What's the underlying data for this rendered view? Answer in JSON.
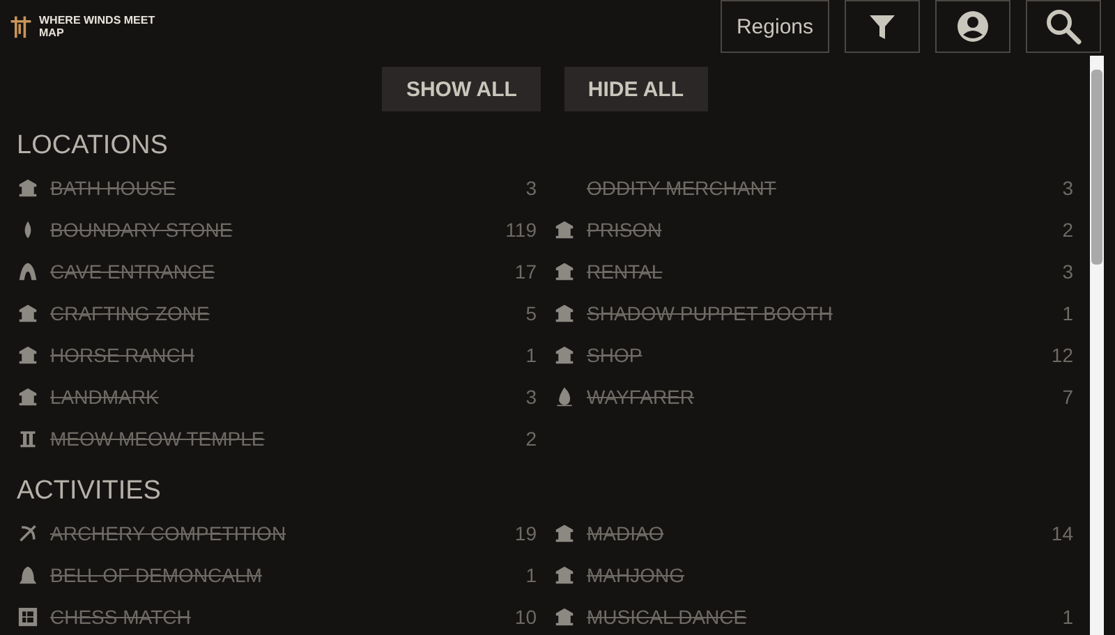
{
  "logo": {
    "title": "WHERE WINDS MEET",
    "subtitle": "MAP"
  },
  "header_buttons": {
    "regions": "Regions"
  },
  "actions": [
    "SHOW ALL",
    "HIDE ALL"
  ],
  "sections": [
    {
      "title": "LOCATIONS",
      "items": [
        {
          "label": "BATH HOUSE",
          "count": "3",
          "hidden": true
        },
        {
          "label": "BOUNDARY STONE",
          "count": "119",
          "hidden": true
        },
        {
          "label": "CAVE ENTRANCE",
          "count": "17",
          "hidden": true
        },
        {
          "label": "CRAFTING ZONE",
          "count": "5",
          "hidden": true
        },
        {
          "label": "HORSE RANCH",
          "count": "1",
          "hidden": true
        },
        {
          "label": "LANDMARK",
          "count": "3",
          "hidden": true
        },
        {
          "label": "MEOW MEOW TEMPLE",
          "count": "2",
          "hidden": true
        },
        {
          "label": "ODDITY MERCHANT",
          "count": "3",
          "hidden": true
        },
        {
          "label": "PRISON",
          "count": "2",
          "hidden": true
        },
        {
          "label": "RENTAL",
          "count": "3",
          "hidden": true
        },
        {
          "label": "SHADOW PUPPET BOOTH",
          "count": "1",
          "hidden": true
        },
        {
          "label": "SHOP",
          "count": "12",
          "hidden": true
        },
        {
          "label": "WAYFARER",
          "count": "7",
          "hidden": true
        }
      ]
    },
    {
      "title": "ACTIVITIES",
      "items": [
        {
          "label": "ARCHERY COMPETITION",
          "count": "19",
          "hidden": true
        },
        {
          "label": "BELL OF DEMONCALM",
          "count": "1",
          "hidden": true
        },
        {
          "label": "CHESS MATCH",
          "count": "10",
          "hidden": true
        },
        {
          "label": "MADIAO",
          "count": "14",
          "hidden": true
        },
        {
          "label": "MAHJONG",
          "hidden": true
        },
        {
          "label": "MUSICAL DANCE",
          "count": "1",
          "hidden": true
        }
      ]
    }
  ]
}
